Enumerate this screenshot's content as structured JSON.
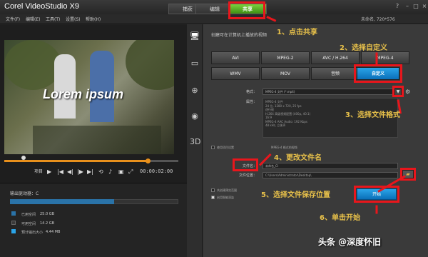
{
  "app": {
    "title": "Corel VideoStudio X9",
    "project_info": "未命名, 720*576"
  },
  "tabs": [
    {
      "label": "捕获"
    },
    {
      "label": "编辑"
    },
    {
      "label": "共享"
    }
  ],
  "menu": [
    {
      "label": "文件(F)"
    },
    {
      "label": "编辑(E)"
    },
    {
      "label": "工具(T)"
    },
    {
      "label": "设置(S)"
    },
    {
      "label": "帮助(H)"
    }
  ],
  "preview": {
    "overlay_text": "Lorem ipsum",
    "timecode": "00:00:02:00",
    "mode_label": "项目",
    "progress": 0.82
  },
  "drive": {
    "label": "输出驱动器：C",
    "used_fraction": 0.62,
    "legend": [
      {
        "label": "已用空间",
        "value": "25.0 GB",
        "color": "#2a73a8"
      },
      {
        "label": "可用空间",
        "value": "14.2 GB",
        "color": "#3a3a3a"
      },
      {
        "label": "预计输出大小",
        "value": "4.44 MB",
        "color": "#2aa4e8"
      }
    ]
  },
  "share": {
    "heading": "创建可在计算机上播放的视频",
    "formats_row1": [
      "AVI",
      "MPEG-2",
      "AVC / H.264",
      "MPEG-4"
    ],
    "formats_row2": [
      "WMV",
      "MOV",
      "音频",
      "自定义"
    ],
    "format_label": "格式：",
    "format_value": "MPEG-4 文件 (*.mp4)",
    "properties_label": "属性：",
    "properties_text": "MPEG-4 文件\n24 位, 1280 x 720, 25 fps\n逐行帧\nH.264 高级视频配置 (400p, 40.1)\n16:9\nMPEG-4 AAC Audio: 192 Kbps\n48 kHz, 立体声",
    "filename_label": "文件名：",
    "filename_value": "未命名_Cl",
    "filepath_label": "文件位置：",
    "filepath_value": "C:\\Users\\Administrator\\Desktop\\",
    "checkbox1": "共创建预览范围",
    "checkbox2": "启用智能渲染",
    "start_button": "开始",
    "extra_label": "使用项目设置",
    "extra_note": "MPEG-4 格式的视频"
  },
  "annotations": [
    {
      "text": "1、点击共享"
    },
    {
      "text": "2、选择自定义"
    },
    {
      "text": "3、选择文件格式"
    },
    {
      "text": "4、更改文件名"
    },
    {
      "text": "5、选择文件保存位置"
    },
    {
      "text": "6、单击开始"
    }
  ],
  "watermark": "头条 @深度怀旧",
  "colors": {
    "accent_green": "#5cb82a",
    "accent_blue": "#1a8ad4",
    "annotation_red": "#e8161c",
    "annotation_text": "#e8c14a"
  }
}
